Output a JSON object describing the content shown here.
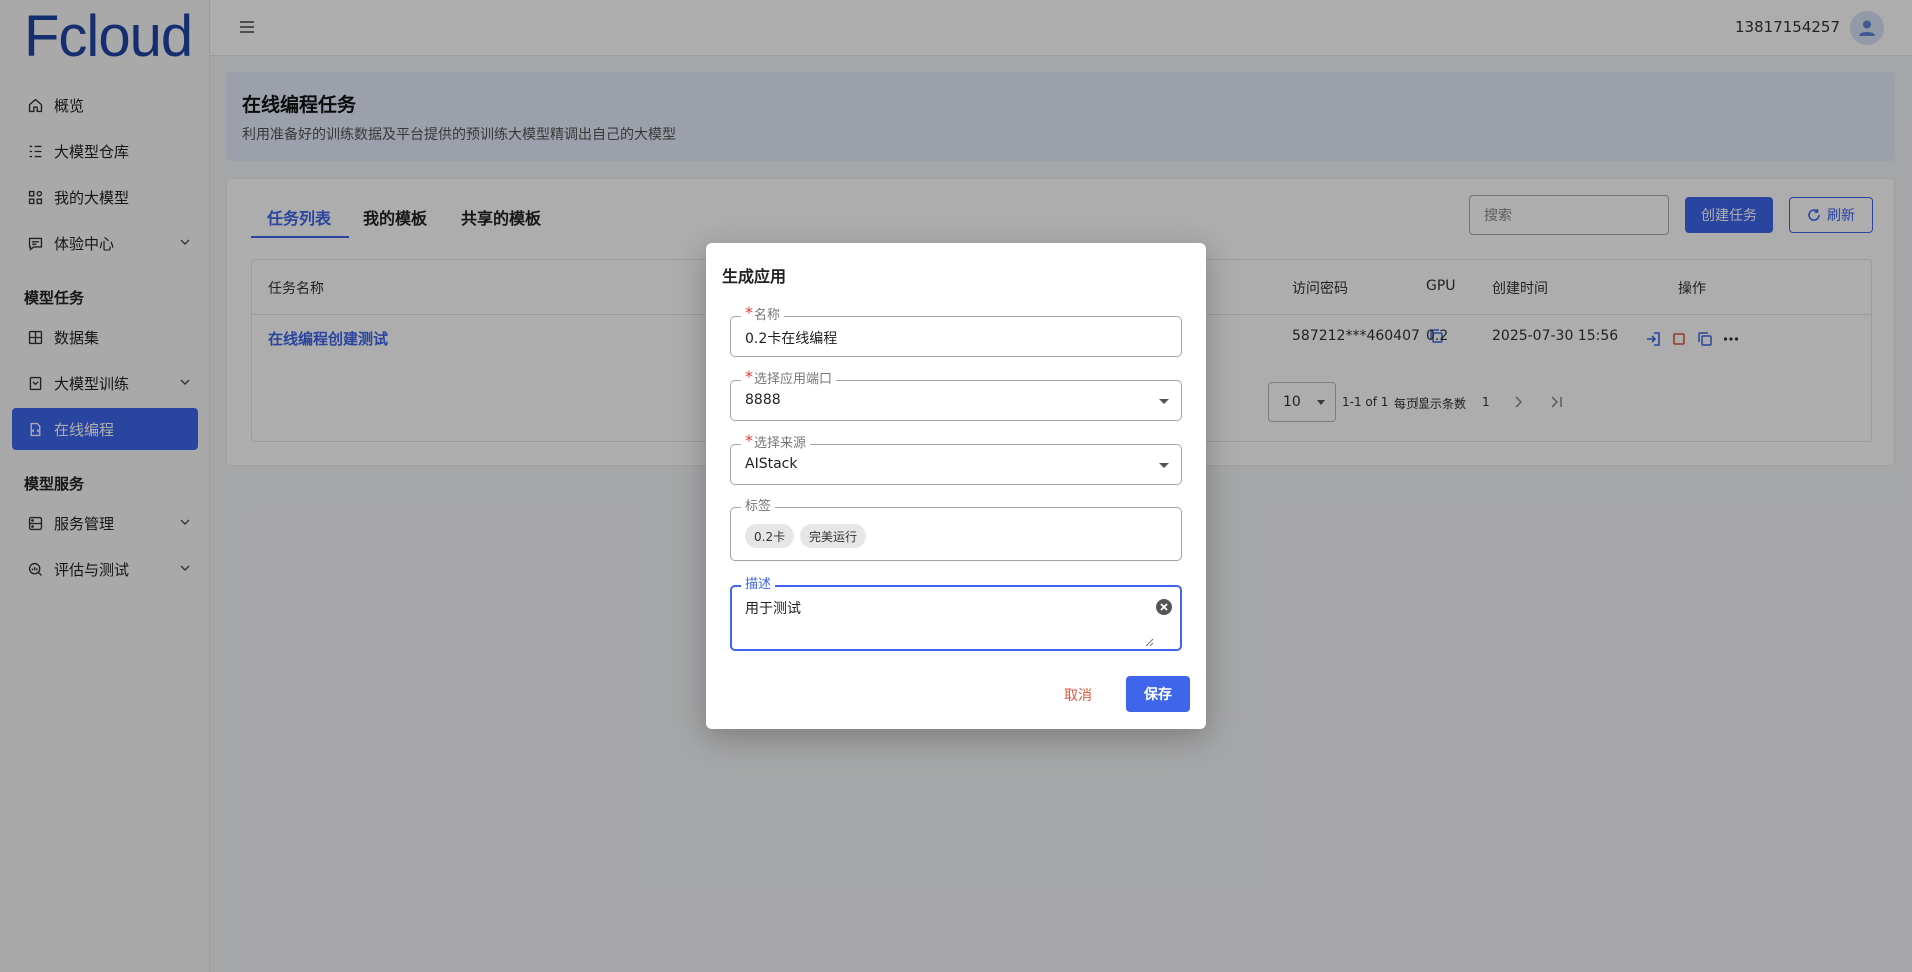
{
  "brand": {
    "logo_text": "Fcloud"
  },
  "sidebar": {
    "items": [
      {
        "label": "概览",
        "icon": "home-icon"
      },
      {
        "label": "大模型仓库",
        "icon": "list-icon"
      },
      {
        "label": "我的大模型",
        "icon": "apps-icon"
      },
      {
        "label": "体验中心",
        "icon": "chat-icon"
      }
    ],
    "section_tasks": "模型任务",
    "task_items": [
      {
        "label": "数据集",
        "icon": "grid-icon"
      },
      {
        "label": "大模型训练",
        "icon": "file-icon"
      },
      {
        "label": "在线编程",
        "icon": "code-icon"
      }
    ],
    "section_service": "模型服务",
    "service_items": [
      {
        "label": "服务管理",
        "icon": "server-icon"
      },
      {
        "label": "评估与测试",
        "icon": "search-chart-icon"
      }
    ]
  },
  "topbar": {
    "user_phone": "13817154257"
  },
  "page": {
    "title": "在线编程任务",
    "subtitle": "利用准备好的训练数据及平台提供的预训练大模型精调出自己的大模型"
  },
  "tabs": [
    "任务列表",
    "我的模板",
    "共享的模板"
  ],
  "toolbar": {
    "search_placeholder": "搜索",
    "create_label": "创建任务",
    "refresh_label": "刷新"
  },
  "table": {
    "columns": {
      "name": "任务名称",
      "password": "访问密码",
      "gpu": "GPU",
      "created": "创建时间",
      "actions": "操作"
    },
    "rows": [
      {
        "name": "在线编程创建测试",
        "password": "587212***460407",
        "gpu": "0.2",
        "created": "2025-07-30 15:56"
      }
    ]
  },
  "pagination": {
    "per_page_label": "每页显示条数",
    "per_page_value": "10",
    "range": "1-1 of 1",
    "current_page": "1"
  },
  "modal": {
    "title": "生成应用",
    "fields": {
      "name": {
        "label": "名称",
        "value": "0.2卡在线编程"
      },
      "port": {
        "label": "选择应用端口",
        "value": "8888"
      },
      "source": {
        "label": "选择来源",
        "value": "AIStack"
      },
      "tags": {
        "label": "标签",
        "values": [
          "0.2卡",
          "完美运行"
        ]
      },
      "description": {
        "label": "描述",
        "value": "用于测试"
      }
    },
    "cancel_label": "取消",
    "save_label": "保存"
  },
  "colors": {
    "primary": "#3f66ea",
    "danger": "#e53935",
    "cancel": "#e0563b"
  }
}
